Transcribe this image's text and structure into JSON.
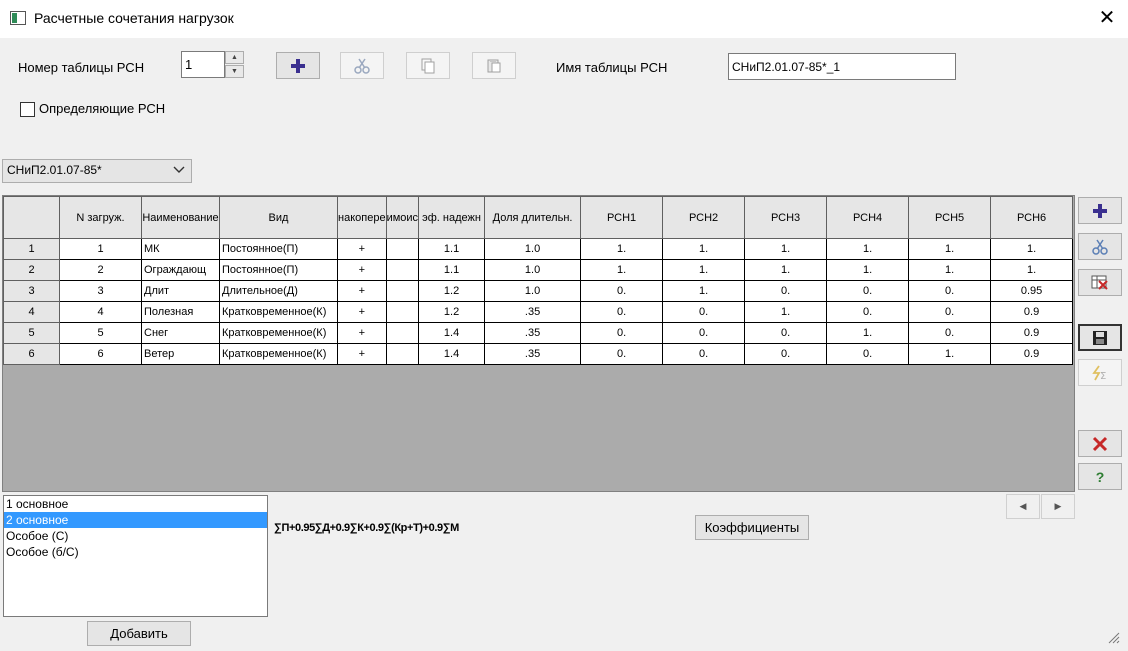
{
  "window": {
    "title": "Расчетные сочетания нагрузок"
  },
  "header": {
    "table_number_label": "Номер таблицы РСН",
    "table_number_value": "1",
    "table_name_label": "Имя таблицы РСН",
    "table_name_value": "СНиП2.01.07-85*_1",
    "defining_label": "Определяющие РСН"
  },
  "norm_select": {
    "value": "СНиП2.01.07-85*"
  },
  "grid": {
    "columns": [
      "N загруж.",
      "Наименование",
      "Вид",
      "накопере",
      "имоис",
      "эф. надежн",
      "Доля длительн.",
      "РСН1",
      "РСН2",
      "РСН3",
      "РСН4",
      "РСН5",
      "РСН6"
    ],
    "rows": [
      {
        "rownum": "1",
        "cells": [
          "1",
          "МК",
          "Постоянное(П)",
          "+",
          "",
          "1.1",
          "1.0",
          "1.",
          "1.",
          "1.",
          "1.",
          "1.",
          "1."
        ]
      },
      {
        "rownum": "2",
        "cells": [
          "2",
          "Ограждающ",
          "Постоянное(П)",
          "+",
          "",
          "1.1",
          "1.0",
          "1.",
          "1.",
          "1.",
          "1.",
          "1.",
          "1."
        ]
      },
      {
        "rownum": "3",
        "cells": [
          "3",
          "Длит",
          "Длительное(Д)",
          "+",
          "",
          "1.2",
          "1.0",
          "0.",
          "1.",
          "0.",
          "0.",
          "0.",
          "0.95"
        ]
      },
      {
        "rownum": "4",
        "cells": [
          "4",
          "Полезная",
          "Кратковременное(К)",
          "+",
          "",
          "1.2",
          ".35",
          "0.",
          "0.",
          "1.",
          "0.",
          "0.",
          "0.9"
        ]
      },
      {
        "rownum": "5",
        "cells": [
          "5",
          "Снег",
          "Кратковременное(К)",
          "+",
          "",
          "1.4",
          ".35",
          "0.",
          "0.",
          "0.",
          "1.",
          "0.",
          "0.9"
        ]
      },
      {
        "rownum": "6",
        "cells": [
          "6",
          "Ветер",
          "Кратковременное(К)",
          "+",
          "",
          "1.4",
          ".35",
          "0.",
          "0.",
          "0.",
          "0.",
          "1.",
          "0.9"
        ]
      }
    ]
  },
  "combo_list": {
    "items": [
      "1 основное",
      "2 основное",
      "Особое (С)",
      "Особое (б/С)"
    ],
    "selected_index": 1
  },
  "formula": "∑П+0.95∑Д+0.9∑К+0.9∑(Кр+Т)+0.9∑М",
  "buttons": {
    "coefficients": "Коэффициенты",
    "add": "Добавить"
  },
  "colors": {
    "selection": "#3399ff",
    "grid_background": "#ababab",
    "add_icon": "#3a2f8f",
    "delete_icon": "#c62828"
  }
}
